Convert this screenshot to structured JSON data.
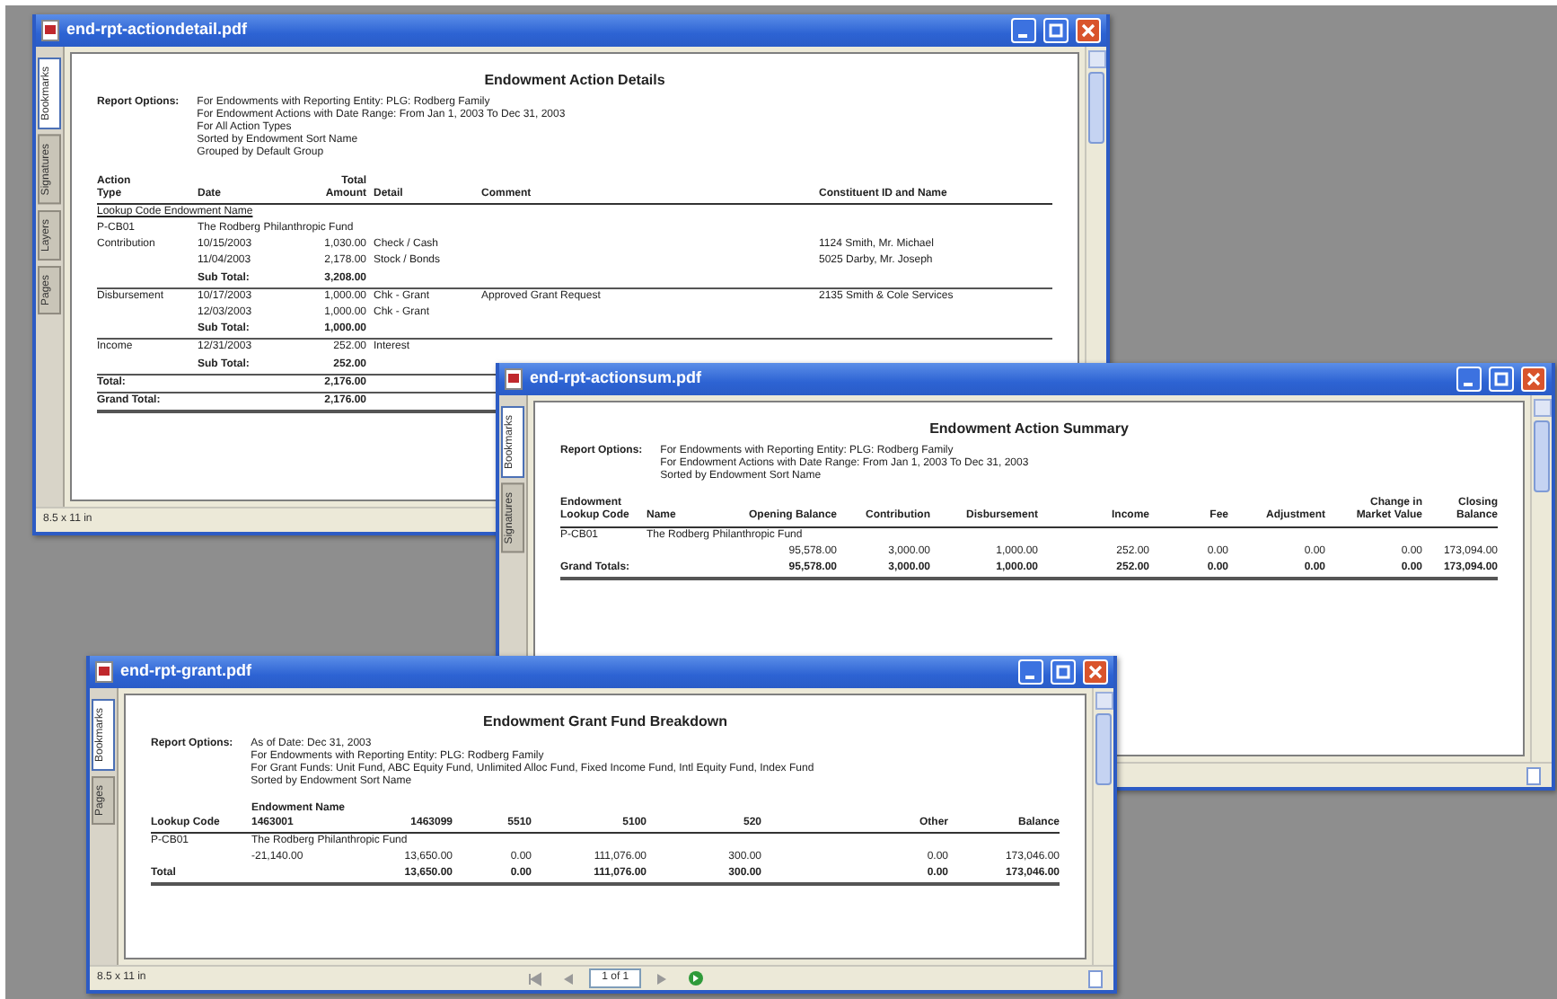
{
  "windows": [
    {
      "title": "end-rpt-actiondetail.pdf",
      "tabs": [
        {
          "label": "Bookmarks",
          "selected": true
        },
        {
          "label": "Signatures",
          "selected": false
        },
        {
          "label": "Layers",
          "selected": false
        },
        {
          "label": "Pages",
          "selected": false
        }
      ],
      "report": {
        "title": "Endowment Action Details",
        "options_label": "Report Options:",
        "options": [
          "For Endowments with Reporting Entity: PLG: Rodberg Family",
          "For Endowment Actions with Date Range: From Jan 1, 2003 To Dec 31, 2003",
          "For All Action Types",
          "Sorted by Endowment Sort Name",
          "Grouped by Default Group"
        ],
        "columns": [
          "Action\nType",
          "Date",
          "Total\nAmount",
          "Detail",
          "Comment",
          "Constituent ID and Name"
        ],
        "rows": [
          {
            "kind": "group",
            "cells": [
              "Lookup Code  Endowment Name"
            ]
          },
          {
            "kind": "fund",
            "cells": [
              "P-CB01",
              "The Rodberg Philanthropic Fund"
            ]
          },
          {
            "kind": "data",
            "cells": [
              "Contribution",
              "10/15/2003",
              "1,030.00",
              "Check / Cash",
              null,
              "1124 Smith, Mr. Michael"
            ]
          },
          {
            "kind": "data",
            "cells": [
              null,
              "11/04/2003",
              "2,178.00",
              "Stock / Bonds",
              null,
              "5025 Darby, Mr. Joseph"
            ]
          },
          {
            "kind": "subtotal",
            "cells": [
              null,
              "Sub Total:",
              "3,208.00",
              null,
              null,
              null
            ]
          },
          {
            "kind": "data",
            "cells": [
              "Disbursement",
              "10/17/2003",
              "1,000.00",
              "Chk - Grant",
              "Approved Grant Request",
              "2135 Smith & Cole Services"
            ]
          },
          {
            "kind": "data",
            "cells": [
              null,
              "12/03/2003",
              "1,000.00",
              "Chk - Grant",
              null,
              null
            ]
          },
          {
            "kind": "subtotal",
            "cells": [
              null,
              "Sub Total:",
              "1,000.00",
              null,
              null,
              null
            ]
          },
          {
            "kind": "data",
            "cells": [
              "Income",
              "12/31/2003",
              "252.00",
              "Interest",
              null,
              null
            ]
          },
          {
            "kind": "subtotal",
            "cells": [
              null,
              "Sub Total:",
              "252.00",
              null,
              null,
              null
            ]
          },
          {
            "kind": "subtotal",
            "cells": [
              "Total:",
              null,
              "2,176.00",
              null,
              null,
              null
            ]
          },
          {
            "kind": "total",
            "cells": [
              "Grand Total:",
              null,
              "2,176.00",
              null,
              null,
              null
            ]
          }
        ]
      },
      "status": {
        "page_size": "8.5 x 11 in"
      }
    },
    {
      "title": "end-rpt-actionsum.pdf",
      "tabs": [
        {
          "label": "Bookmarks",
          "selected": true
        },
        {
          "label": "Signatures",
          "selected": false
        }
      ],
      "report": {
        "title": "Endowment Action Summary",
        "options_label": "Report Options:",
        "options": [
          "For Endowments with Reporting Entity: PLG: Rodberg Family",
          "For Endowment Actions with Date Range: From Jan 1, 2003 To Dec 31, 2003",
          "Sorted by Endowment Sort Name"
        ],
        "columns": [
          "Endowment\nLookup Code",
          "Name",
          "Opening Balance",
          "Contribution",
          "Disbursement",
          "Income",
          "Fee",
          "Adjustment",
          "Change in\nMarket Value",
          "Closing Balance"
        ],
        "rows": [
          {
            "kind": "fund",
            "cells": [
              "P-CB01",
              "The Rodberg Philanthropic Fund"
            ]
          },
          {
            "kind": "data",
            "cells": [
              null,
              null,
              "95,578.00",
              "3,000.00",
              "1,000.00",
              "252.00",
              "0.00",
              "0.00",
              "0.00",
              "173,094.00"
            ]
          },
          {
            "kind": "total",
            "cells": [
              "Grand Totals:",
              null,
              "95,578.00",
              "3,000.00",
              "1,000.00",
              "252.00",
              "0.00",
              "0.00",
              "0.00",
              "173,094.00"
            ]
          }
        ]
      }
    },
    {
      "title": "end-rpt-grant.pdf",
      "tabs": [
        {
          "label": "Bookmarks",
          "selected": true
        },
        {
          "label": "Pages",
          "selected": false
        }
      ],
      "report": {
        "title": "Endowment Grant Fund Breakdown",
        "options_label": "Report Options:",
        "options": [
          "As of Date: Dec 31, 2003",
          "For Endowments with Reporting Entity: PLG: Rodberg Family",
          "For Grant Funds: Unit Fund, ABC Equity Fund, Unlimited Alloc Fund, Fixed Income Fund, Intl Equity Fund, Index Fund",
          "Sorted by Endowment Sort Name"
        ],
        "columns": [
          "Lookup Code",
          "Endowment Name\n1463001",
          "\n1463099",
          "\n5510",
          "\n5100",
          "\n520",
          "\nOther",
          "\nBalance"
        ],
        "rows": [
          {
            "kind": "fund",
            "cells": [
              "P-CB01",
              "The Rodberg Philanthropic Fund"
            ]
          },
          {
            "kind": "data",
            "cells": [
              null,
              "-21,140.00",
              "13,650.00",
              "0.00",
              "111,076.00",
              "300.00",
              "0.00",
              "173,046.00"
            ]
          },
          {
            "kind": "total",
            "cells": [
              "Total",
              null,
              "13,650.00",
              "0.00",
              "111,076.00",
              "300.00",
              "0.00",
              "173,046.00"
            ]
          }
        ]
      },
      "status": {
        "page_size": "8.5 x 11 in",
        "page": "1 of 1"
      }
    }
  ]
}
